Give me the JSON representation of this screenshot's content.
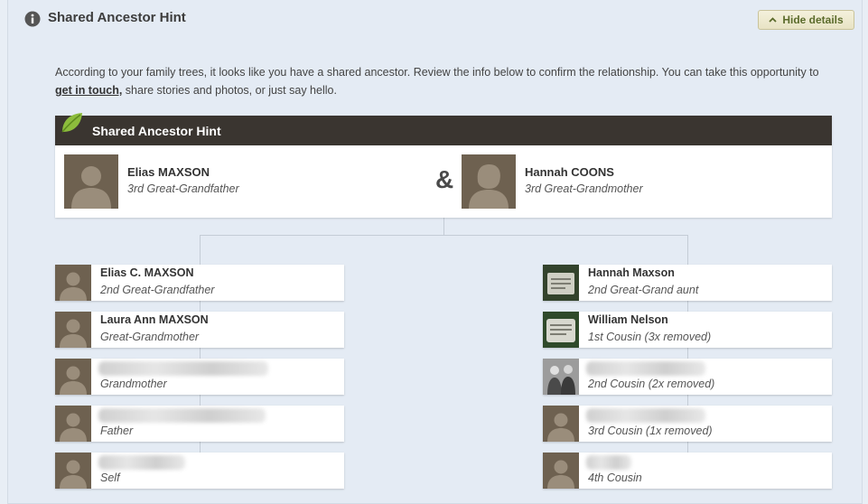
{
  "header": {
    "title": "Shared Ancestor Hint",
    "hide_label": "Hide details"
  },
  "intro": {
    "text_before": "According to your family trees, it looks like you have a shared ancestor. Review the info below to confirm the relationship. You can take this opportunity to ",
    "link": "get in touch,",
    "text_after": " share stories and photos, or just say hello."
  },
  "hint_box": {
    "title": "Shared Ancestor Hint",
    "ampersand": "&",
    "ancestor1": {
      "name": "Elias MAXSON",
      "relation": "3rd Great-Grandfather"
    },
    "ancestor2": {
      "name": "Hannah COONS",
      "relation": "3rd Great-Grandmother"
    }
  },
  "left_line": [
    {
      "name": "Elias C. MAXSON",
      "relation": "2nd Great-Grandfather"
    },
    {
      "name": "Laura Ann MAXSON",
      "relation": "Great-Grandmother"
    },
    {
      "name": "",
      "relation": "Grandmother"
    },
    {
      "name": "",
      "relation": "Father"
    },
    {
      "name": "",
      "relation": "Self"
    }
  ],
  "right_line": [
    {
      "name": "Hannah Maxson",
      "relation": "2nd Great-Grand aunt"
    },
    {
      "name": "William Nelson",
      "relation": "1st Cousin (3x removed)"
    },
    {
      "name": "",
      "relation": "2nd Cousin (2x removed)"
    },
    {
      "name": "",
      "relation": "3rd Cousin (1x removed)"
    },
    {
      "name": "",
      "relation": "4th Cousin"
    }
  ],
  "colors": {
    "header_bar": "#3a3530",
    "photo_bg": "#6e6150",
    "panel_bg": "#e4ebf4",
    "button_text": "#5b6b2b"
  }
}
